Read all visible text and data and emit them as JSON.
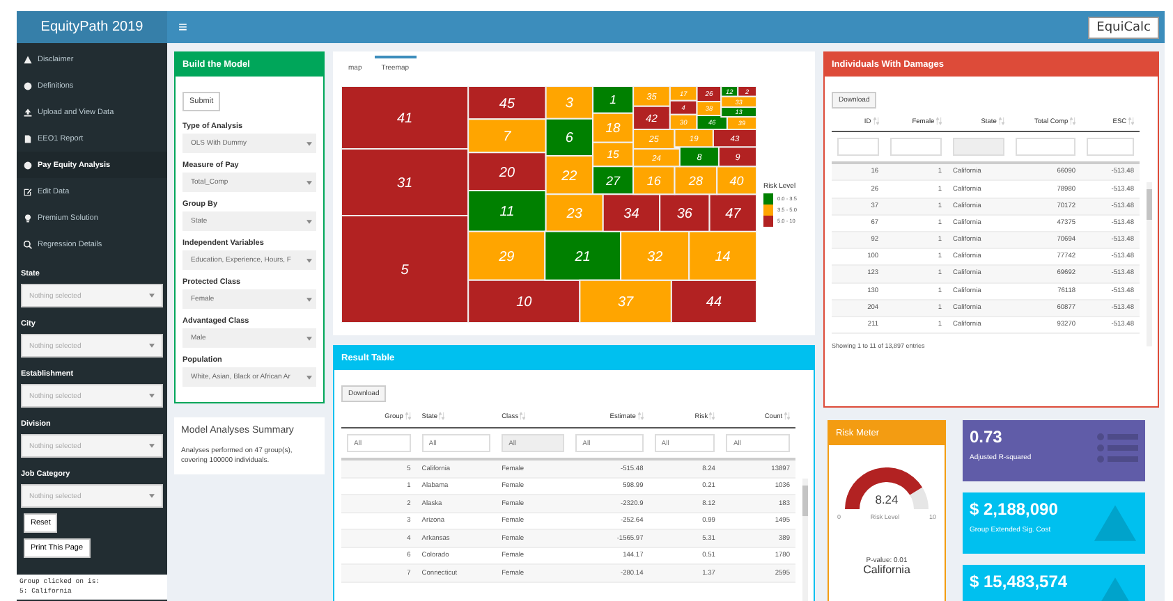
{
  "header": {
    "logo": "EquityPath 2019",
    "menu_glyph": "≡",
    "brand": "EquiCalc"
  },
  "sidebar": {
    "items": [
      {
        "label": "Disclaimer",
        "selected": false
      },
      {
        "label": "Definitions",
        "selected": false
      },
      {
        "label": "Upload and View Data",
        "selected": false
      },
      {
        "label": "EEO1 Report",
        "selected": false
      },
      {
        "label": "Pay Equity Analysis",
        "selected": true
      },
      {
        "label": "Edit Data",
        "selected": false
      },
      {
        "label": "Premium Solution",
        "selected": false
      },
      {
        "label": "Regression Details",
        "selected": false
      }
    ],
    "filters": [
      {
        "label": "State",
        "placeholder": "Nothing selected"
      },
      {
        "label": "City",
        "placeholder": "Nothing selected"
      },
      {
        "label": "Establishment",
        "placeholder": "Nothing selected"
      },
      {
        "label": "Division",
        "placeholder": "Nothing selected"
      },
      {
        "label": "Job Category",
        "placeholder": "Nothing selected"
      }
    ],
    "buttons": [
      "Reset",
      "Print This Page"
    ],
    "output": [
      "Group clicked on is:",
      "5: California"
    ]
  },
  "build_model": {
    "title": "Build the Model",
    "submit": "Submit",
    "fields": [
      {
        "label": "Type of Analysis",
        "value": "OLS With Dummy"
      },
      {
        "label": "Measure of Pay",
        "value": "Total_Comp"
      },
      {
        "label": "Group By",
        "value": "State"
      },
      {
        "label": "Independent Variables",
        "value": "Education, Experience, Hours, F"
      },
      {
        "label": "Protected Class",
        "value": "Female"
      },
      {
        "label": "Advantaged Class",
        "value": "Male"
      },
      {
        "label": "Population",
        "value": "White, Asian, Black or African Ar"
      }
    ]
  },
  "summary": {
    "title": "Model Analyses Summary",
    "text": "Analyses performed on 47 group(s), covering 100000 individuals."
  },
  "map_panel": {
    "tabs": [
      {
        "label": "map",
        "selected": false
      },
      {
        "label": "Treemap",
        "selected": true
      }
    ],
    "tiles": [
      {
        "label": "41",
        "color": "#b22222"
      },
      {
        "label": "31",
        "color": "#b22222"
      },
      {
        "label": "5",
        "color": "#b22222"
      },
      {
        "label": "45",
        "color": "#b22222"
      },
      {
        "label": "7",
        "color": "#ffa500"
      },
      {
        "label": "20",
        "color": "#b22222"
      },
      {
        "label": "11",
        "color": "#008000"
      },
      {
        "label": "29",
        "color": "#ffa500"
      },
      {
        "label": "10",
        "color": "#b22222"
      },
      {
        "label": "3",
        "color": "#ffa500"
      },
      {
        "label": "6",
        "color": "#008000"
      },
      {
        "label": "1",
        "color": "#008000"
      },
      {
        "label": "18",
        "color": "#ffa500"
      },
      {
        "label": "15",
        "color": "#ffa500"
      },
      {
        "label": "22",
        "color": "#ffa500"
      },
      {
        "label": "27",
        "color": "#008000"
      },
      {
        "label": "23",
        "color": "#ffa500"
      },
      {
        "label": "21",
        "color": "#008000"
      },
      {
        "label": "37",
        "color": "#ffa500"
      },
      {
        "label": "44",
        "color": "#b22222"
      },
      {
        "label": "32",
        "color": "#ffa500"
      },
      {
        "label": "14",
        "color": "#ffa500"
      },
      {
        "label": "34",
        "color": "#b22222"
      },
      {
        "label": "36",
        "color": "#b22222"
      },
      {
        "label": "47",
        "color": "#b22222"
      },
      {
        "label": "16",
        "color": "#ffa500"
      },
      {
        "label": "28",
        "color": "#ffa500"
      },
      {
        "label": "40",
        "color": "#ffa500"
      },
      {
        "label": "25",
        "color": "#ffa500"
      },
      {
        "label": "24",
        "color": "#ffa500"
      },
      {
        "label": "8",
        "color": "#008000"
      },
      {
        "label": "9",
        "color": "#b22222"
      },
      {
        "label": "19",
        "color": "#ffa500"
      },
      {
        "label": "43",
        "color": "#b22222"
      },
      {
        "label": "35",
        "color": "#ffa500"
      },
      {
        "label": "42",
        "color": "#b22222"
      },
      {
        "label": "17",
        "color": "#ffa500"
      },
      {
        "label": "4",
        "color": "#b22222"
      },
      {
        "label": "30",
        "color": "#ffa500"
      },
      {
        "label": "26",
        "color": "#b22222"
      },
      {
        "label": "38",
        "color": "#ffa500"
      },
      {
        "label": "46",
        "color": "#008000"
      },
      {
        "label": "12",
        "color": "#008000"
      },
      {
        "label": "2",
        "color": "#b22222"
      },
      {
        "label": "33",
        "color": "#ffa500"
      },
      {
        "label": "13",
        "color": "#008000"
      },
      {
        "label": "39",
        "color": "#ffa500"
      }
    ],
    "legend": {
      "title": "Risk Level",
      "items": [
        {
          "label": "0.0 - 3.5",
          "color": "#008000"
        },
        {
          "label": "3.5 - 5.0",
          "color": "#ffa500"
        },
        {
          "label": "5.0 - 10",
          "color": "#b22222"
        }
      ]
    }
  },
  "result_table": {
    "title": "Result Table",
    "download": "Download",
    "columns": [
      "Group",
      "State",
      "Class",
      "Estimate",
      "Risk",
      "Count"
    ],
    "filters": [
      {
        "placeholder": "All",
        "disabled": false
      },
      {
        "placeholder": "All",
        "disabled": false
      },
      {
        "placeholder": "All",
        "disabled": true
      },
      {
        "placeholder": "All",
        "disabled": false
      },
      {
        "placeholder": "All",
        "disabled": false
      },
      {
        "placeholder": "All",
        "disabled": false
      }
    ],
    "rows": [
      [
        "5",
        "California",
        "Female",
        "-515.48",
        "8.24",
        "13897"
      ],
      [
        "1",
        "Alabama",
        "Female",
        "598.99",
        "0.21",
        "1036"
      ],
      [
        "2",
        "Alaska",
        "Female",
        "-2320.9",
        "8.12",
        "183"
      ],
      [
        "3",
        "Arizona",
        "Female",
        "-252.64",
        "0.99",
        "1495"
      ],
      [
        "4",
        "Arkansas",
        "Female",
        "-1565.97",
        "5.31",
        "389"
      ],
      [
        "6",
        "Colorado",
        "Female",
        "144.17",
        "0.51",
        "1780"
      ],
      [
        "7",
        "Connecticut",
        "Female",
        "-280.14",
        "1.37",
        "2595"
      ]
    ]
  },
  "individuals": {
    "title": "Individuals With Damages",
    "download": "Download",
    "columns": [
      "ID",
      "Female",
      "State",
      "Total Comp",
      "ESC"
    ],
    "filters": [
      {
        "disabled": false
      },
      {
        "disabled": false
      },
      {
        "disabled": true
      },
      {
        "disabled": false
      },
      {
        "disabled": false
      }
    ],
    "rows": [
      [
        "16",
        "1",
        "California",
        "66090",
        "-513.48"
      ],
      [
        "26",
        "1",
        "California",
        "78980",
        "-513.48"
      ],
      [
        "37",
        "1",
        "California",
        "70172",
        "-513.48"
      ],
      [
        "67",
        "1",
        "California",
        "47375",
        "-513.48"
      ],
      [
        "92",
        "1",
        "California",
        "70694",
        "-513.48"
      ],
      [
        "100",
        "1",
        "California",
        "77742",
        "-513.48"
      ],
      [
        "123",
        "1",
        "California",
        "69692",
        "-513.48"
      ],
      [
        "130",
        "1",
        "California",
        "76118",
        "-513.48"
      ],
      [
        "204",
        "1",
        "California",
        "60877",
        "-513.48"
      ],
      [
        "211",
        "1",
        "California",
        "93270",
        "-513.48"
      ]
    ],
    "footer": "Showing 1 to 11 of 13,897 entries"
  },
  "risk_meter": {
    "title": "Risk Meter",
    "value": "8.24",
    "caption": "Risk Level",
    "min": "0",
    "max": "10",
    "p_value": "P-value: 0.01",
    "state": "California"
  },
  "value_boxes": [
    {
      "value": "0.73",
      "label": "Adjusted R-squared",
      "color": "#605ca8"
    },
    {
      "value": "$ 2,188,090",
      "label": "Group Extended Sig. Cost",
      "color": "#00c0ef"
    },
    {
      "value": "$ 15,483,574",
      "color": "#00c0ef"
    }
  ]
}
